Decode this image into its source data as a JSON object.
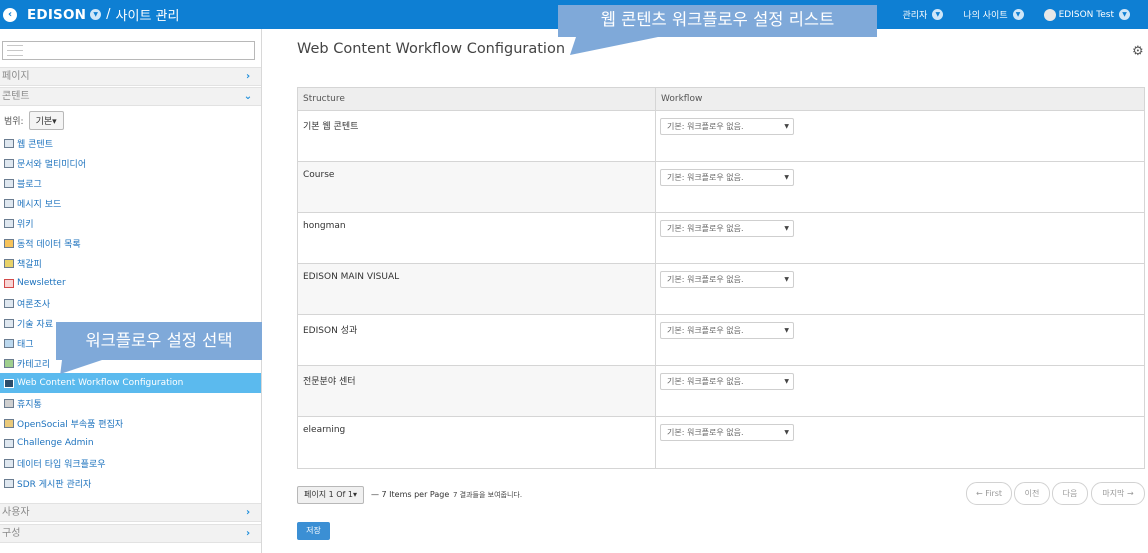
{
  "topbar": {
    "back_icon": "circle-left-arrow",
    "site_name": "EDISON",
    "separator": "/",
    "page_name": "사이트 관리",
    "right_items": [
      {
        "label": "관리자"
      },
      {
        "label": "나의 사이트"
      },
      {
        "label": "EDISON Test"
      }
    ],
    "color": "#0e7fd3"
  },
  "callouts": {
    "top": "웹 콘텐츠 워크플로우 설정 리스트",
    "side": "워크플로우 설정 선택"
  },
  "sidebar": {
    "sections": {
      "pages": "페이지",
      "content": "콘텐트",
      "users": "사용자",
      "config": "구성"
    },
    "scope_label": "범위:",
    "scope_value": "기본▾",
    "items": [
      {
        "label": "웹 콘텐트"
      },
      {
        "label": "문서와 멀티미디어"
      },
      {
        "label": "블로그"
      },
      {
        "label": "메시지 보드"
      },
      {
        "label": "위키"
      },
      {
        "label": "동적 데이터 목록"
      },
      {
        "label": "책갈피"
      },
      {
        "label": "Newsletter"
      },
      {
        "label": "여론조사"
      },
      {
        "label": "기술 자료"
      },
      {
        "label": "태그"
      },
      {
        "label": "카테고리"
      },
      {
        "label": "Web Content Workflow Configuration"
      },
      {
        "label": "휴지통"
      },
      {
        "label": "OpenSocial 부속품 편집자"
      },
      {
        "label": "Challenge Admin"
      },
      {
        "label": "데이터 타입 워크플로우"
      },
      {
        "label": "SDR 게시판 관리자"
      }
    ],
    "active_index": 12,
    "active_color": "#5bbaee"
  },
  "main": {
    "title": "Web Content Workflow Configuration",
    "settings_icon": "gear-icon",
    "columns": [
      "Structure",
      "Workflow"
    ],
    "rows": [
      {
        "structure": "기본 웹 콘텐트",
        "workflow": "기본: 워크플로우 없음."
      },
      {
        "structure": "Course",
        "workflow": "기본: 워크플로우 없음."
      },
      {
        "structure": "hongman",
        "workflow": "기본: 워크플로우 없음."
      },
      {
        "structure": "EDISON MAIN VISUAL",
        "workflow": "기본: 워크플로우 없음."
      },
      {
        "structure": "EDISON 성과",
        "workflow": "기본: 워크플로우 없음."
      },
      {
        "structure": "전문분야 센터",
        "workflow": "기본: 워크플로우 없음."
      },
      {
        "structure": "elearning",
        "workflow": "기본: 워크플로우 없음."
      }
    ],
    "pager": {
      "page_label": "페이지 1 Of 1▾",
      "items_per_page": "— 7 Items per Page",
      "results": "7 결과들을 보여줍니다.",
      "first": "← First",
      "prev": "이전",
      "next": "다음",
      "last": "마지막 →"
    },
    "save_label": "저장"
  }
}
